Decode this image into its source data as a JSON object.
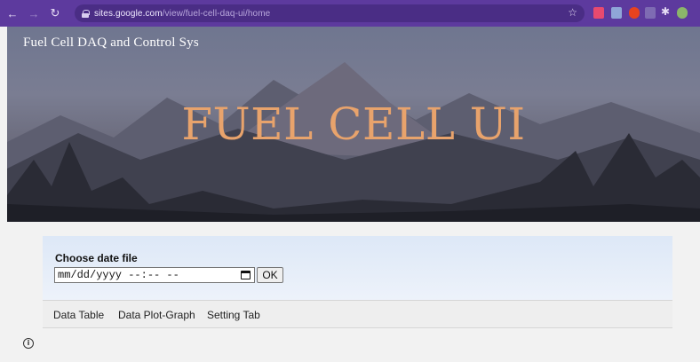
{
  "browser": {
    "url_host": "sites.google.com",
    "url_path": "/view/fuel-cell-daq-ui/home"
  },
  "site": {
    "name": "Fuel Cell DAQ and Control Sys",
    "hero_title": "FUEL CELL UI"
  },
  "form": {
    "label": "Choose date file",
    "datetime_placeholder": "mm/dd/yyyy --:-- --",
    "ok_label": "OK"
  },
  "tabs": [
    {
      "label": "Data Table"
    },
    {
      "label": "Data Plot-Graph"
    },
    {
      "label": "Setting Tab"
    }
  ],
  "colors": {
    "browser_chrome": "#5d3a9e",
    "hero_title": "#e8a36c"
  },
  "icons": [
    "back-icon",
    "forward-icon",
    "reload-icon",
    "lock-icon",
    "bookmark-star-icon",
    "calendar-icon",
    "info-icon"
  ]
}
